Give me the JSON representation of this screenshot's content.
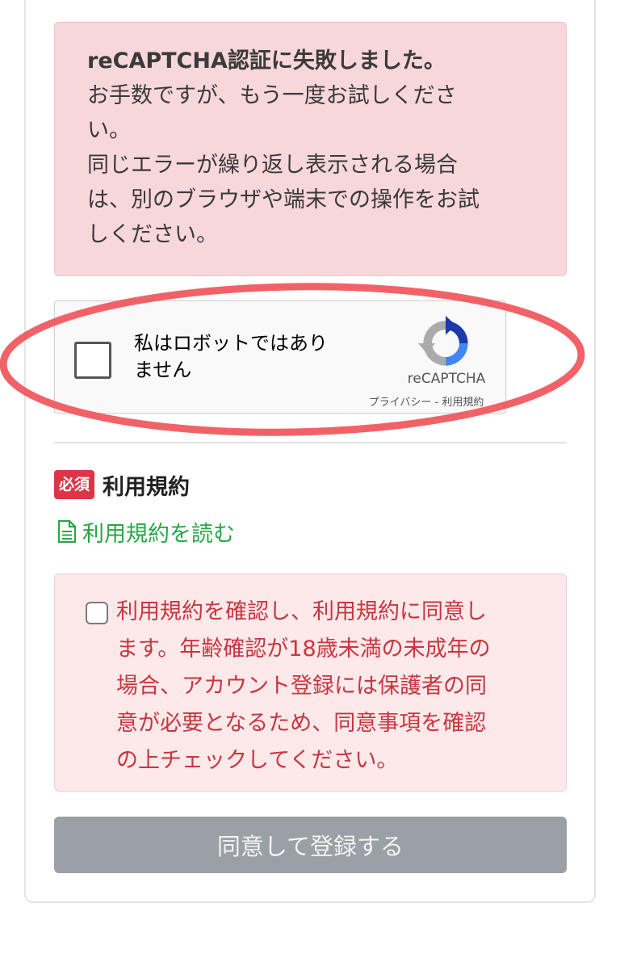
{
  "error": {
    "lines": [
      "reCAPTCHA認証に失敗しました。",
      "お手数ですが、もう一度お試しくださ",
      "い。",
      "同じエラーが繰り返し表示される場合",
      "は、別のブラウザや端末での操作をお試",
      "しください。"
    ]
  },
  "recaptcha": {
    "label_line1": "私はロボットではあり",
    "label_line2": "ません",
    "brand": "reCAPTCHA",
    "privacy": "プライバシー",
    "separator": " - ",
    "terms": "利用規約",
    "checked": false
  },
  "terms_section": {
    "badge": "必須",
    "title": "利用規約",
    "read_link": "利用規約を読む",
    "icon": "document-icon"
  },
  "agreement": {
    "checked": false,
    "lines": [
      "利用規約を確認し、利用規約に同意し",
      "ます。年齢確認が18歳未満の未成年の",
      "場合、アカウント登録には保護者の同",
      "意が必要となるため、同意事項を確認",
      "の上チェックしてください。"
    ]
  },
  "submit": {
    "label": "同意して登録する",
    "enabled": false
  },
  "colors": {
    "error_bg": "#f8d7da",
    "badge": "#dc3545",
    "link": "#28a745",
    "agree_text": "#c6373f",
    "button": "#9aa0a5",
    "highlight": "#f0555b"
  }
}
